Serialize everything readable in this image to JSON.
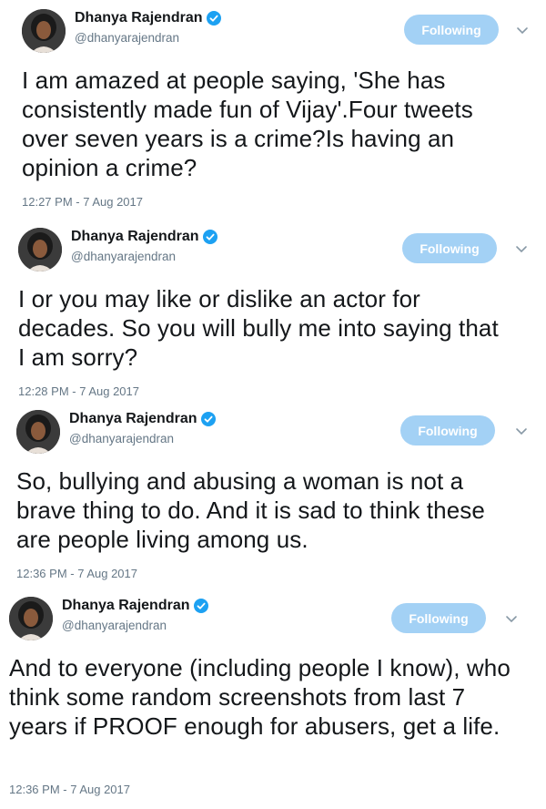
{
  "tweets": [
    {
      "author": {
        "display_name": "Dhanya Rajendran",
        "handle": "@dhanyarajendran",
        "verified": true
      },
      "follow_label": "Following",
      "text": "I am amazed at people saying, 'She has consistently made fun of Vijay'.Four tweets over seven years is a crime?Is having an opinion a crime?",
      "timestamp": "12:27 PM - 7 Aug 2017"
    },
    {
      "author": {
        "display_name": "Dhanya Rajendran",
        "handle": "@dhanyarajendran",
        "verified": true
      },
      "follow_label": "Following",
      "text": "I or you may like or dislike an actor for decades. So you will bully me into saying that I am sorry?",
      "timestamp": "12:28 PM - 7 Aug 2017"
    },
    {
      "author": {
        "display_name": "Dhanya Rajendran",
        "handle": "@dhanyarajendran",
        "verified": true
      },
      "follow_label": "Following",
      "text": "So, bullying and abusing a woman is not a brave thing to do. And it is sad to think these are people living among us.",
      "timestamp": "12:36 PM - 7 Aug 2017"
    },
    {
      "author": {
        "display_name": "Dhanya Rajendran",
        "handle": "@dhanyarajendran",
        "verified": true
      },
      "follow_label": "Following",
      "text": "And to everyone (including people I know), who think some random screenshots from last 7 years if PROOF enough for abusers, get a life.",
      "timestamp": "12:36 PM - 7 Aug 2017"
    }
  ],
  "icons": {
    "verified": "verified-badge-icon",
    "menu": "chevron-down-icon"
  },
  "colors": {
    "following_button": "#a3d1f5",
    "verified_badge": "#1da1f2",
    "secondary_text": "#657786",
    "primary_text": "#14171a"
  }
}
